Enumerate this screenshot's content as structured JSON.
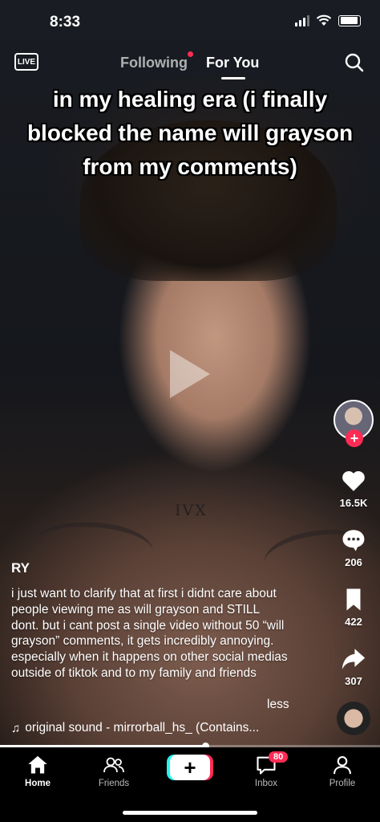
{
  "status_bar": {
    "time": "8:33"
  },
  "header": {
    "following": "Following",
    "for_you": "For You",
    "live": "LIVE"
  },
  "caption": "in my healing era (i finally blocked the name will grayson from my comments)",
  "video": {
    "tattoo": "IVX",
    "progress": 0.54
  },
  "actions": {
    "likes": "16.5K",
    "comments": "206",
    "saves": "422",
    "shares": "307"
  },
  "post": {
    "author": "RY",
    "description": "i just want to clarify that at first i didnt care about people viewing me as will grayson and STILL dont. but i cant post a single video without 50 “will grayson” comments, it gets incredibly annoying. especially when it happens on other social medias outside of tiktok and to my family and friends",
    "less": "less",
    "sound": "original sound - mirrorball_hs_ (Contains..."
  },
  "nav": {
    "home": "Home",
    "friends": "Friends",
    "inbox": "Inbox",
    "inbox_badge": "80",
    "profile": "Profile"
  },
  "colors": {
    "accent": "#fe2c55",
    "cyan": "#25f4ee"
  }
}
